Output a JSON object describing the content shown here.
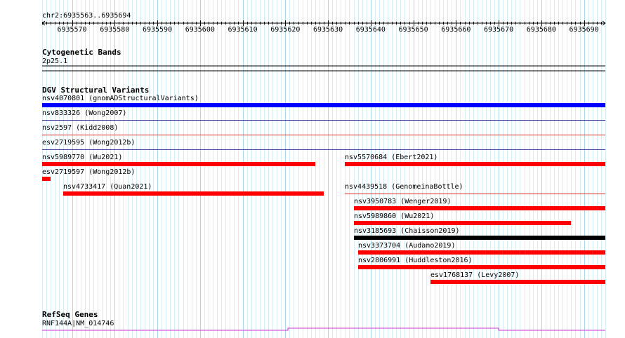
{
  "region": {
    "label": "chr2:6935563..6935694",
    "start": 6935563,
    "end": 6935694
  },
  "ruler": {
    "ticks": [
      6935570,
      6935580,
      6935590,
      6935600,
      6935610,
      6935620,
      6935630,
      6935640,
      6935650,
      6935660,
      6935670,
      6935680,
      6935690
    ]
  },
  "colors": {
    "grid": "#a9d8e8",
    "red": "#ff0000",
    "blue": "#0000ff",
    "black": "#000000",
    "gene": "#cc33cc",
    "row_red": "#dd2222",
    "row_blue": "#333399"
  },
  "tracks": {
    "cytobands": {
      "title": "Cytogenetic Bands",
      "band": "2p25.1"
    },
    "dgv": {
      "title": "DGV Structural Variants",
      "features": [
        {
          "label": "nsv4070801 (gnomADStructuralVariants)",
          "start": 6935563,
          "end": 6935694,
          "color": "blue",
          "row": 0
        },
        {
          "label": "nsv833326 (Wong2007)",
          "start": 6935563,
          "end": 6935694,
          "color": "none",
          "row": 1
        },
        {
          "label": "nsv2597 (Kidd2008)",
          "start": 6935563,
          "end": 6935694,
          "color": "none",
          "row": 2
        },
        {
          "label": "esv2719595 (Wong2012b)",
          "start": 6935563,
          "end": 6935694,
          "color": "none",
          "row": 3
        },
        {
          "label": "nsv5989770 (Wu2021)",
          "start": 6935563,
          "end": 6935626,
          "color": "red",
          "row": 4
        },
        {
          "label": "nsv5570684 (Ebert2021)",
          "start": 6935634,
          "end": 6935694,
          "color": "red",
          "row": 4
        },
        {
          "label": "esv2719597 (Wong2012b)",
          "start": 6935563,
          "end": 6935564,
          "color": "red",
          "row": 5
        },
        {
          "label": "nsv4733417 (Quan2021)",
          "start": 6935568,
          "end": 6935628,
          "color": "red",
          "row": 6
        },
        {
          "label": "nsv4439518 (GenomeinaBottle)",
          "start": 6935634,
          "end": 6935694,
          "color": "none",
          "row": 6
        },
        {
          "label": "nsv3950783 (Wenger2019)",
          "start": 6935636,
          "end": 6935694,
          "color": "red",
          "row": 7
        },
        {
          "label": "nsv5989860 (Wu2021)",
          "start": 6935636,
          "end": 6935686,
          "color": "red",
          "row": 8
        },
        {
          "label": "nsv3185693 (Chaisson2019)",
          "start": 6935636,
          "end": 6935694,
          "color": "black",
          "row": 9
        },
        {
          "label": "nsv3373704 (Audano2019)",
          "start": 6935637,
          "end": 6935694,
          "color": "red",
          "row": 10
        },
        {
          "label": "nsv2806991 (Huddleston2016)",
          "start": 6935637,
          "end": 6935694,
          "color": "red",
          "row": 11
        },
        {
          "label": "esv1768137 (Levy2007)",
          "start": 6935654,
          "end": 6935694,
          "color": "red",
          "row": 12
        }
      ]
    },
    "refseq": {
      "title": "RefSeq Genes",
      "gene": "RNF144A|NM_014746"
    }
  }
}
